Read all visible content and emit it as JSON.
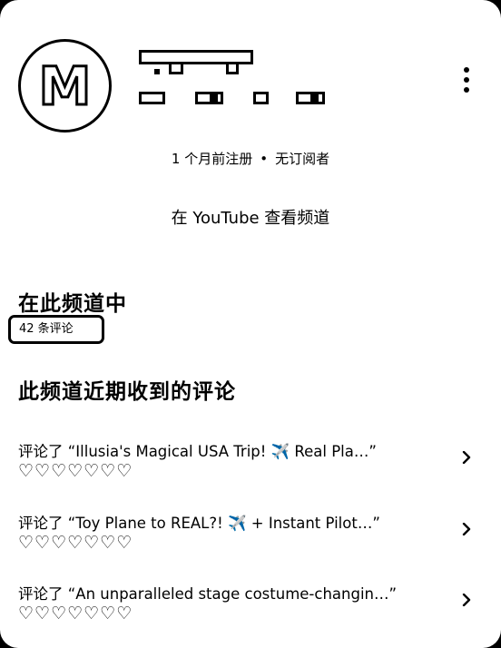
{
  "channel": {
    "avatar_letter": "M",
    "meta_joined": "1 个月前注册",
    "meta_separator": "•",
    "meta_subscribers": "无订阅者",
    "view_on_youtube": "在 YouTube 查看频道"
  },
  "stats": {
    "section_title": "在此频道中",
    "comment_count": "42 条评论"
  },
  "recent": {
    "title": "此频道近期收到的评论",
    "items": [
      {
        "text": "评论了 “Illusia's Magical USA Trip! ✈️ Real Pla…”",
        "hearts": "♡♡♡♡♡♡♡"
      },
      {
        "text": "评论了 “Toy Plane to REAL?! ✈️ + Instant Pilot…”",
        "hearts": "♡♡♡♡♡♡♡"
      },
      {
        "text": "评论了 “An unparalleled stage costume-changin…”",
        "hearts": "♡♡♡♡♡♡♡"
      }
    ]
  },
  "icons": {
    "menu": "kebab-menu-icon",
    "chevron": "chevron-right-icon",
    "heart": "heart-outline-icon"
  }
}
